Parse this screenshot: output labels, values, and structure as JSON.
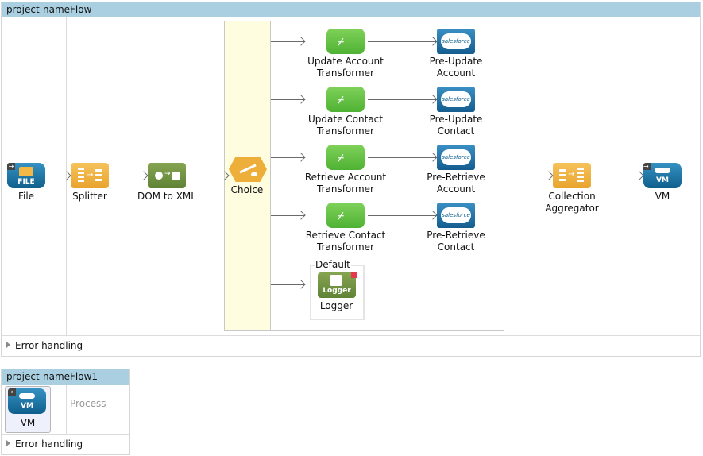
{
  "flows": [
    {
      "title": "project-nameFlow",
      "source": {
        "label": "File",
        "icon": "file-endpoint-icon",
        "icon_text": "FILE"
      },
      "process": [
        {
          "label": "Splitter",
          "icon": "splitter-icon"
        },
        {
          "label": "DOM to XML",
          "icon": "dom-to-xml-icon"
        },
        {
          "label": "Choice",
          "icon": "choice-router-icon"
        }
      ],
      "choice_routes": [
        {
          "transformer": [
            "Update Account",
            "Transformer"
          ],
          "target": [
            "Pre-Update",
            "Account"
          ]
        },
        {
          "transformer": [
            "Update Contact",
            "Transformer"
          ],
          "target": [
            "Pre-Update",
            "Contact"
          ]
        },
        {
          "transformer": [
            "Retrieve Account",
            "Transformer"
          ],
          "target": [
            "Pre-Retrieve",
            "Account"
          ]
        },
        {
          "transformer": [
            "Retrieve Contact",
            "Transformer"
          ],
          "target": [
            "Pre-Retrieve",
            "Contact"
          ]
        }
      ],
      "salesforce_icon_text": "salesforce",
      "default_route": {
        "caption": "Default",
        "label": "Logger",
        "icon_text": "Logger"
      },
      "after_choice": [
        {
          "label": [
            "Collection",
            "Aggregator"
          ],
          "icon": "collection-aggregator-icon"
        },
        {
          "label": [
            "VM"
          ],
          "icon": "vm-endpoint-icon",
          "icon_text": "VM"
        }
      ],
      "error_handling": "Error handling"
    },
    {
      "title": "project-nameFlow1",
      "source": {
        "label": "VM",
        "icon": "vm-endpoint-icon",
        "icon_text": "VM"
      },
      "process_placeholder": "Process",
      "error_handling": "Error handling"
    }
  ]
}
